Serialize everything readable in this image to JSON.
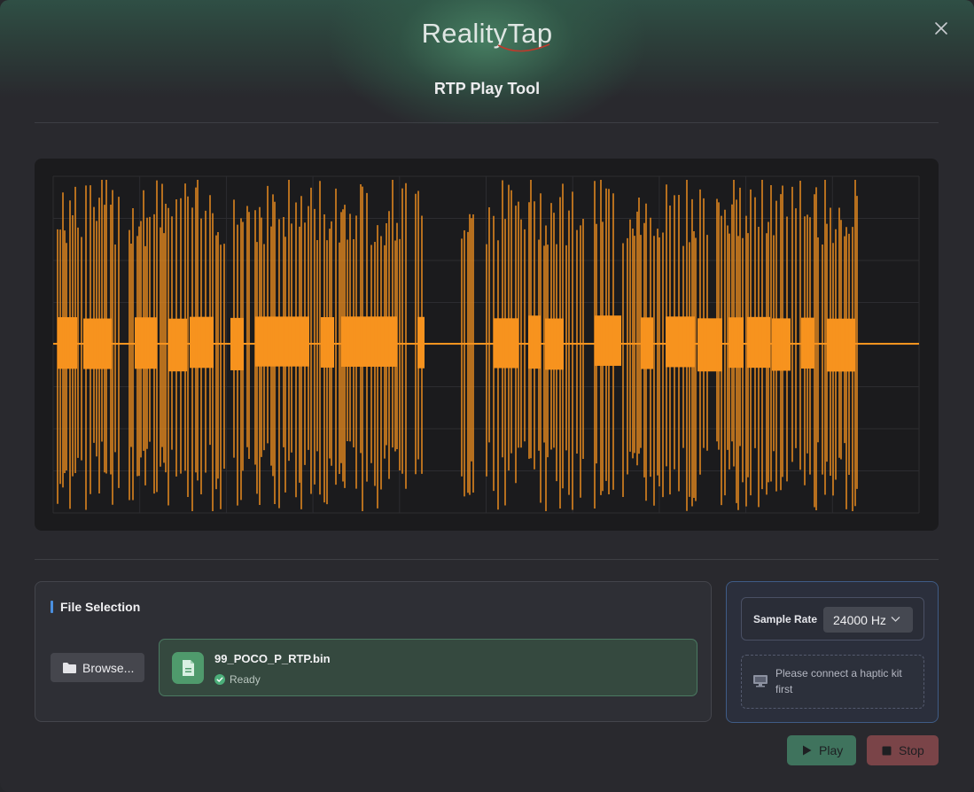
{
  "header": {
    "brand": "RealityTap",
    "title": "RTP Play Tool"
  },
  "icons": {
    "close": "close-icon",
    "folder": "folder-icon",
    "file": "file-icon",
    "ready": "check-circle-icon",
    "chevron": "chevron-down-icon",
    "monitor": "monitor-icon",
    "play": "play-icon",
    "stop": "stop-icon"
  },
  "colors": {
    "waveform": "#f7931e",
    "accent_blue": "#4a8fe0",
    "ready_green": "#4caf7a"
  },
  "waveform": {
    "color": "#f7931e"
  },
  "file_selection": {
    "heading": "File Selection",
    "browse_label": "Browse...",
    "file_name": "99_POCO_P_RTP.bin",
    "status": "Ready"
  },
  "config": {
    "sample_rate_label": "Sample Rate",
    "sample_rate_value": "24000 Hz",
    "connect_message": "Please connect a haptic kit first"
  },
  "actions": {
    "play_label": "Play",
    "stop_label": "Stop"
  }
}
